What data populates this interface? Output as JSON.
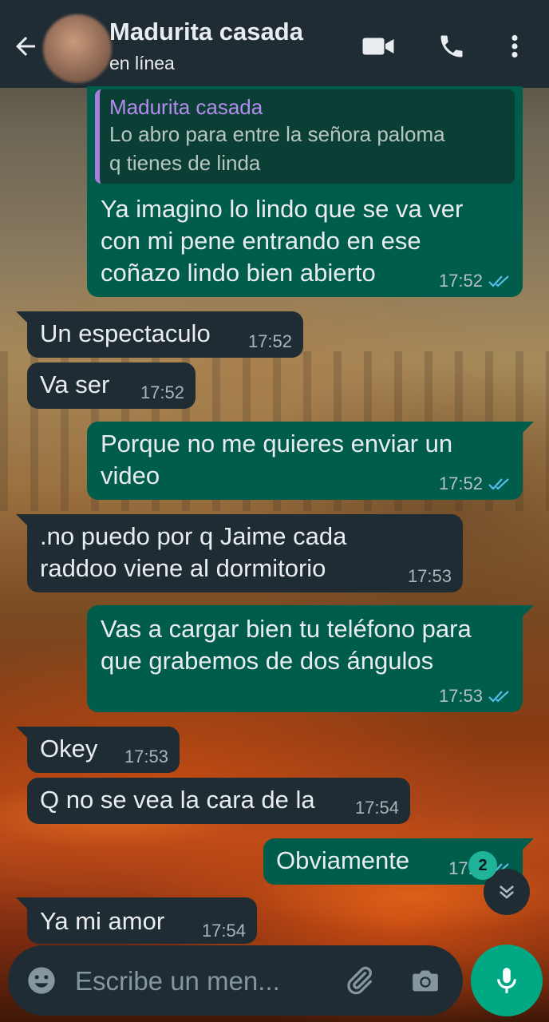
{
  "header": {
    "contact_name": "Madurita casada",
    "status": "en línea",
    "icons": [
      "back-arrow-icon",
      "video-call-icon",
      "phone-call-icon",
      "more-menu-icon"
    ]
  },
  "messages": [
    {
      "direction": "outgoing",
      "quoted": {
        "name": "Madurita casada",
        "text": "Lo abro para entre la señora paloma\nq tienes de linda"
      },
      "text": "Ya imagino lo lindo que se va ver\ncon mi pene entrando en ese\ncoñazo lindo bien abierto",
      "time": "17:52",
      "read": true
    },
    {
      "direction": "incoming",
      "text": "Un espectaculo",
      "time": "17:52"
    },
    {
      "direction": "incoming",
      "text": "Va ser",
      "time": "17:52"
    },
    {
      "direction": "outgoing",
      "text": "Porque no me quieres enviar un\nvideo",
      "time": "17:52",
      "read": true
    },
    {
      "direction": "incoming",
      "text": ".no puedo por q Jaime cada\nraddoo viene al dormitorio",
      "time": "17:53"
    },
    {
      "direction": "outgoing",
      "text": "Vas a cargar bien tu teléfono para\nque grabemos de dos ángulos",
      "time": "17:53",
      "read": true
    },
    {
      "direction": "incoming",
      "text": "Okey",
      "time": "17:53"
    },
    {
      "direction": "incoming",
      "text": "Q no se vea la cara de la",
      "time": "17:54"
    },
    {
      "direction": "outgoing",
      "text": "Obviamente",
      "time": "17:5",
      "read": true
    },
    {
      "direction": "incoming",
      "text": "Ya mi amor",
      "time": "17:54"
    }
  ],
  "scroll_down": {
    "unread_count": "2"
  },
  "composer": {
    "placeholder": "Escribe un men...",
    "icons": [
      "emoji-icon",
      "attach-icon",
      "camera-icon",
      "microphone-icon"
    ]
  },
  "colors": {
    "header_bg": "#1f2c34",
    "outgoing_bubble": "#005c4b",
    "incoming_bubble": "#202c33",
    "accent": "#00a884",
    "read_ticks": "#53bdeb"
  }
}
